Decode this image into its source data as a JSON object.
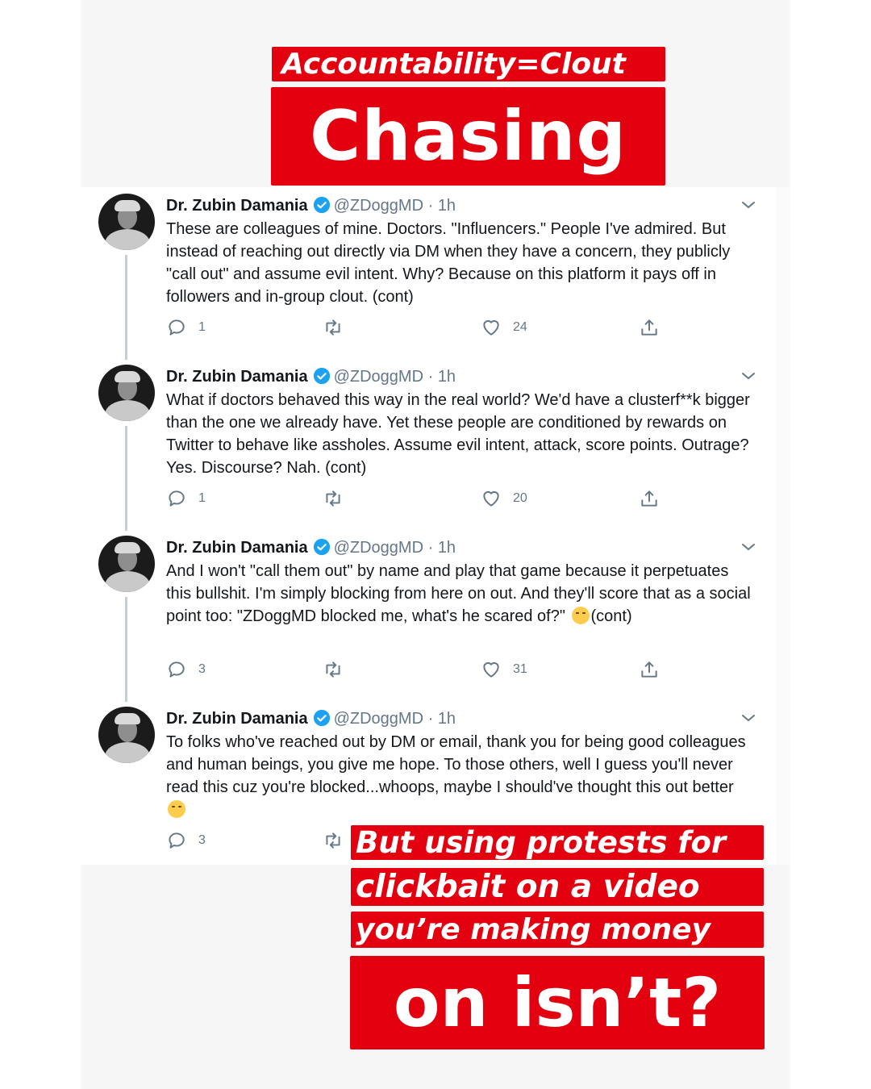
{
  "banners": {
    "top_line1": "Accountability=Clout",
    "top_line2": "Chasing",
    "bottom_line1": "But using protests for",
    "bottom_line2": "clickbait on a video",
    "bottom_line3": "you’re making money",
    "bottom_line4": "on isn’t?"
  },
  "colors": {
    "banner_red": "#e3000f",
    "verified_blue": "#1da1f2",
    "muted_gray": "#657786"
  },
  "tweets": [
    {
      "name": "Dr. Zubin Damania",
      "handle": "@ZDoggMD",
      "time": "1h",
      "text": "These are colleagues of mine. Doctors. \"Influencers.\" People I've admired. But instead of reaching out directly via DM when they have a concern, they publicly \"call out\" and assume evil intent. Why? Because on this platform it pays off in followers and in-group clout. (cont)",
      "text_end": "",
      "emoji": "",
      "replies": "1",
      "retweets": "",
      "likes": "24"
    },
    {
      "name": "Dr. Zubin Damania",
      "handle": "@ZDoggMD",
      "time": "1h",
      "text": "What if doctors behaved this way in the real world? We'd have a clusterf**k bigger than the one we already have. Yet these people are conditioned by rewards on Twitter to behave like assholes. Assume evil intent, attack, score points. Outrage? Yes. Discourse? Nah. (cont)",
      "text_end": "",
      "emoji": "",
      "replies": "1",
      "retweets": "",
      "likes": "20"
    },
    {
      "name": "Dr. Zubin Damania",
      "handle": "@ZDoggMD",
      "time": "1h",
      "text": "And I won't \"call them out\" by name and play that game because it perpetuates this bullshit. I'm simply blocking from here on out. And they'll score that as a social point too: \"ZDoggMD blocked me, what's he scared of?\"",
      "text_end": "(cont)",
      "emoji": "smirking-face-emoji",
      "replies": "3",
      "retweets": "",
      "likes": "31"
    },
    {
      "name": "Dr. Zubin Damania",
      "handle": "@ZDoggMD",
      "time": "1h",
      "text": "To folks who've reached out by DM or email, thank you for being good colleagues and human beings, you give me hope. To those others, well I guess you'll never read this cuz you're blocked...whoops, maybe I should've thought this out better",
      "text_end": "",
      "emoji": "grinning-sweat-emoji",
      "replies": "3",
      "retweets": "",
      "likes": ""
    }
  ],
  "separator": " · ",
  "icons": [
    "verified-badge-icon",
    "chevron-down-icon",
    "reply-icon",
    "retweet-icon",
    "like-heart-icon",
    "share-icon"
  ]
}
